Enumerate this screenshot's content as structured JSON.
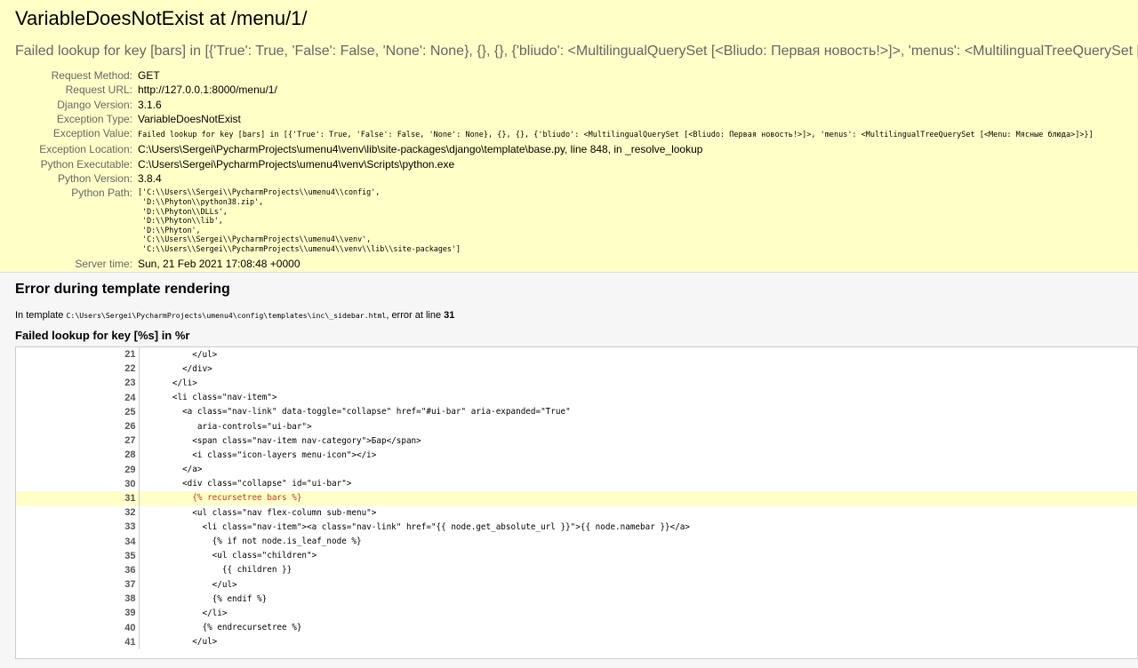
{
  "summary": {
    "title": "VariableDoesNotExist at /menu/1/",
    "exception_value_line": "Failed lookup for key [bars] in [{'True': True, 'False': False, 'None': None}, {}, {}, {'bliudo': <MultilingualQuerySet [<Bliudo: Первая новость!>]>, 'menus': <MultilingualTreeQuerySet [<Menu: Мясные блюда>]>}]",
    "meta": [
      {
        "label": "Request Method:",
        "value": "GET"
      },
      {
        "label": "Request URL:",
        "value": "http://127.0.0.1:8000/menu/1/"
      },
      {
        "label": "Django Version:",
        "value": "3.1.6"
      },
      {
        "label": "Exception Type:",
        "value": "VariableDoesNotExist"
      },
      {
        "label": "Exception Value:",
        "value": "Failed lookup for key [bars] in [{'True': True, 'False': False, 'None': None}, {}, {}, {'bliudo': <MultilingualQuerySet [<Bliudo: Первая новость!>]>, 'menus': <MultilingualTreeQuerySet [<Menu: Мясные блюда>]>}]"
      },
      {
        "label": "Exception Location:",
        "value": "C:\\Users\\Sergei\\PycharmProjects\\umenu4\\venv\\lib\\site-packages\\django\\template\\base.py, line 848, in _resolve_lookup"
      },
      {
        "label": "Python Executable:",
        "value": "C:\\Users\\Sergei\\PycharmProjects\\umenu4\\venv\\Scripts\\python.exe"
      },
      {
        "label": "Python Version:",
        "value": "3.8.4"
      },
      {
        "label": "Python Path:",
        "value": "['C:\\\\Users\\\\Sergei\\\\PycharmProjects\\\\umenu4\\\\config',\n 'D:\\\\Phyton\\\\python38.zip',\n 'D:\\\\Phyton\\\\DLLs',\n 'D:\\\\Phyton\\\\lib',\n 'D:\\\\Phyton',\n 'C:\\\\Users\\\\Sergei\\\\PycharmProjects\\\\umenu4\\\\venv',\n 'C:\\\\Users\\\\Sergei\\\\PycharmProjects\\\\umenu4\\\\venv\\\\lib\\\\site-packages']"
      },
      {
        "label": "Server time:",
        "value": "Sun, 21 Feb 2021 17:08:48 +0000"
      }
    ]
  },
  "template": {
    "heading": "Error during template rendering",
    "intro_prefix": "In template ",
    "template_path": "C:\\Users\\Sergei\\PycharmProjects\\umenu4\\config\\templates\\inc\\_sidebar.html",
    "intro_suffix": ", error at line ",
    "error_line": "31",
    "subheading": "Failed lookup for key [%s] in %r",
    "lines": [
      {
        "n": "21",
        "code": "        </ul>",
        "error": false
      },
      {
        "n": "22",
        "code": "      </div>",
        "error": false
      },
      {
        "n": "23",
        "code": "    </li>",
        "error": false
      },
      {
        "n": "24",
        "code": "    <li class=\"nav-item\">",
        "error": false
      },
      {
        "n": "25",
        "code": "      <a class=\"nav-link\" data-toggle=\"collapse\" href=\"#ui-bar\" aria-expanded=\"True\"",
        "error": false
      },
      {
        "n": "26",
        "code": "         aria-controls=\"ui-bar\">",
        "error": false
      },
      {
        "n": "27",
        "code": "        <span class=\"nav-item nav-category\">Бар</span>",
        "error": false
      },
      {
        "n": "28",
        "code": "        <i class=\"icon-layers menu-icon\"></i>",
        "error": false
      },
      {
        "n": "29",
        "code": "      </a>",
        "error": false
      },
      {
        "n": "30",
        "code": "      <div class=\"collapse\" id=\"ui-bar\">",
        "error": false
      },
      {
        "n": "31",
        "code": "        {% recursetree bars %}",
        "error": true
      },
      {
        "n": "32",
        "code": "        <ul class=\"nav flex-column sub-menu\">",
        "error": false
      },
      {
        "n": "33",
        "code": "          <li class=\"nav-item\"><a class=\"nav-link\" href=\"{{ node.get_absolute_url }}\">{{ node.namebar }}</a>",
        "error": false
      },
      {
        "n": "34",
        "code": "            {% if not node.is_leaf_node %}",
        "error": false
      },
      {
        "n": "35",
        "code": "            <ul class=\"children\">",
        "error": false
      },
      {
        "n": "36",
        "code": "              {{ children }}",
        "error": false
      },
      {
        "n": "37",
        "code": "            </ul>",
        "error": false
      },
      {
        "n": "38",
        "code": "            {% endif %}",
        "error": false
      },
      {
        "n": "39",
        "code": "          </li>",
        "error": false
      },
      {
        "n": "40",
        "code": "          {% endrecursetree %}",
        "error": false
      },
      {
        "n": "41",
        "code": "        </ul>",
        "error": false
      }
    ]
  }
}
